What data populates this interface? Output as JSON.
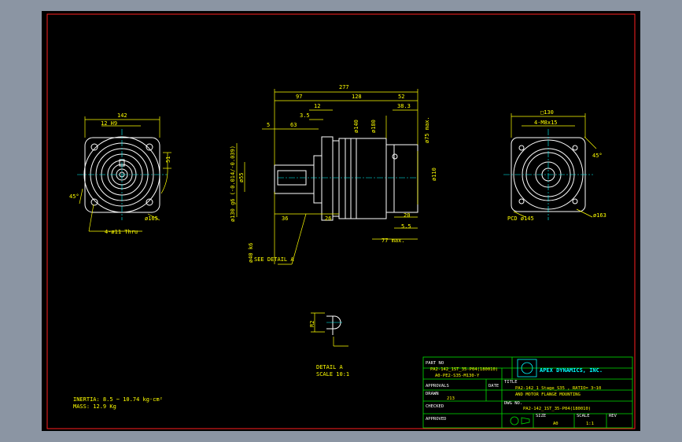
{
  "colors": {
    "background": "#000000",
    "frame": "#ff2020",
    "geometry": "#ffffff",
    "dimension": "#ffff00",
    "titleblock": "#00e000",
    "magenta": "#ff00ff",
    "cyan": "#00ffff"
  },
  "left_view": {
    "dim_142": "142",
    "dim_12h9": "12 H9",
    "dim_51": "51",
    "note_holes": "4-ø11 Thru",
    "angle_45": "45°",
    "dia_165": "ø165"
  },
  "front_view": {
    "dim_277": "277",
    "dim_97": "97",
    "dim_128": "128",
    "dim_52": "52",
    "dim_12": "12",
    "dim_38_3": "38.3",
    "dim_3_5": "3.5",
    "dim_5": "5",
    "dim_63": "63",
    "dim_140": "ø140",
    "dim_180": "ø180",
    "dim_75max": "ø75 max.",
    "dim_110": "ø110",
    "dim_130g6": "ø130 g6 (-0.014/-0.039)",
    "dim_55": "ø55",
    "dim_36": "36",
    "dim_26": "26",
    "dim_20": "20",
    "dim_5_5": "5.5",
    "dim_77max": "77 max.",
    "dim_40k6": "ø40 k6",
    "see_detail": "SEE DETAIL A"
  },
  "right_view": {
    "dim_130sq": "□130",
    "note_m8": "4-M8x15",
    "angle_45": "45°",
    "pcd": "PCD ø145",
    "dia_163": "ø163"
  },
  "detail": {
    "dim_r2": "R2",
    "label": "DETAIL A",
    "scale": "SCALE 10:1"
  },
  "notes": {
    "inertia": "INERTIA: 8.5 ~ 10.74 kg·cm²",
    "mass": "MASS: 12.9  Kg"
  },
  "title_block": {
    "part_no_label": "PART NO",
    "part_no_line1": "PA2-142_1ST_35-P04(180010)",
    "part_no_line2": "A0-PE2-S35-M130-Y",
    "company": "APEX DYNAMICS, INC.",
    "approvals_label": "APPROVALS",
    "date_label": "DATE",
    "drawn_label": "DRAWN",
    "drawn_value": "213",
    "checked_label": "CHECKED",
    "approved_label": "APPROVED",
    "title_label": "TITLE",
    "title_line1": "PA2-142_1 Stage_S35 , RATIO= 3~10",
    "title_line2": "AND MOTOR FLANGE MOUNTING",
    "dwg_label": "DWG NO.",
    "dwg_value": "PA2-142_1ST_35-P04(180010)",
    "size_label": "SIZE",
    "size_value": "A0",
    "scale_label": "SCALE",
    "scale_value": "1:1",
    "rev_label": "REV"
  }
}
